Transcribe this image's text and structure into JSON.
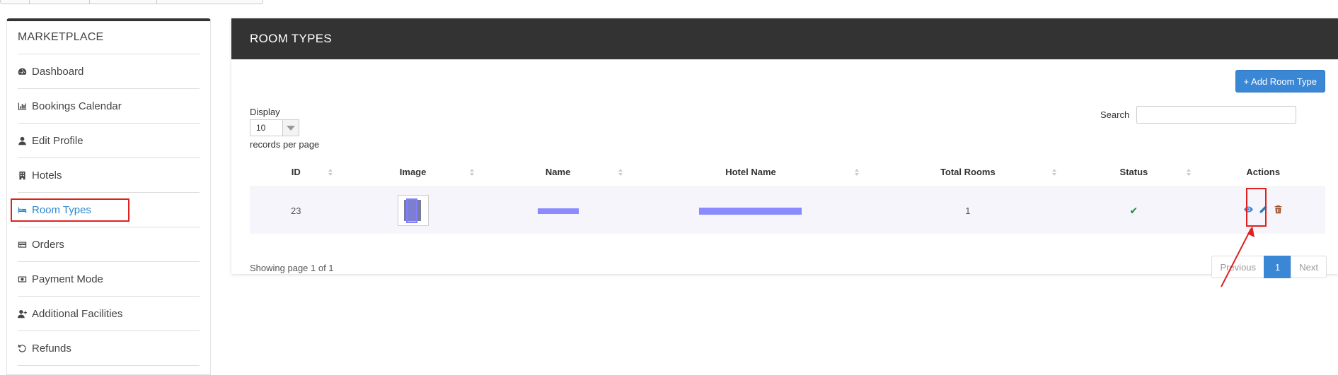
{
  "sidebar": {
    "title": "MARKETPLACE",
    "items": [
      {
        "label": "Dashboard",
        "icon": "dashboard-icon"
      },
      {
        "label": "Bookings Calendar",
        "icon": "bar-chart-icon"
      },
      {
        "label": "Edit Profile",
        "icon": "user-icon"
      },
      {
        "label": "Hotels",
        "icon": "building-icon"
      },
      {
        "label": "Room Types",
        "icon": "bed-icon",
        "active": true
      },
      {
        "label": "Orders",
        "icon": "credit-card-icon"
      },
      {
        "label": "Payment Mode",
        "icon": "money-icon"
      },
      {
        "label": "Additional Facilities",
        "icon": "user-plus-icon"
      },
      {
        "label": "Refunds",
        "icon": "undo-icon"
      }
    ]
  },
  "main": {
    "title": "ROOM TYPES",
    "add_button": "+ Add Room Type",
    "display_label": "Display",
    "display_value": "10",
    "records_label": "records per page",
    "search_label": "Search",
    "search_value": "",
    "table": {
      "headers": [
        "ID",
        "Image",
        "Name",
        "Hotel Name",
        "Total Rooms",
        "Status",
        "Actions"
      ],
      "rows": [
        {
          "id": "23",
          "total_rooms": "1"
        }
      ]
    },
    "showing": "Showing page 1 of 1",
    "pagination": {
      "previous": "Previous",
      "current": "1",
      "next": "Next"
    }
  },
  "colors": {
    "header_bg": "#333333",
    "accent": "#3a87d6",
    "active_link": "#2f87d1",
    "annotation": "#e02020",
    "status_ok": "#1a8a3a"
  }
}
